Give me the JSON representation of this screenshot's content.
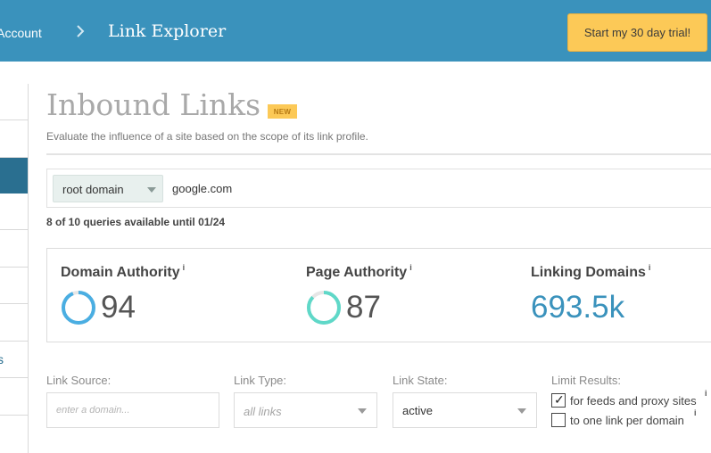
{
  "topbar": {
    "account_crumb": "s Account",
    "title": "Link Explorer",
    "trial_button": "Start my 30 day trial!"
  },
  "sidebar": {
    "partial_text": "s"
  },
  "header": {
    "title": "Inbound Links",
    "badge": "NEW",
    "subtitle": "Evaluate the influence of a site based on the scope of its link profile."
  },
  "search": {
    "scope": "root domain",
    "query": "google.com",
    "quota": "8 of 10 queries available until 01/24"
  },
  "metrics": [
    {
      "label": "Domain Authority",
      "info": "i",
      "value": "94",
      "score": 94,
      "ring_color": "#4aaee2"
    },
    {
      "label": "Page Authority",
      "info": "i",
      "value": "87",
      "score": 87,
      "ring_color": "#5fd8c8"
    },
    {
      "label": "Linking Domains",
      "info": "i",
      "value": "693.5k"
    }
  ],
  "filters": {
    "link_source": {
      "label": "Link Source:",
      "placeholder": "enter a domain..."
    },
    "link_type": {
      "label": "Link Type:",
      "value": "all links"
    },
    "link_state": {
      "label": "Link State:",
      "value": "active"
    },
    "limit_results": {
      "label": "Limit Results:",
      "options": [
        {
          "label": "for feeds and proxy sites",
          "checked": true,
          "info": "i"
        },
        {
          "label": "to one link per domain",
          "checked": false,
          "info": "i"
        }
      ]
    }
  },
  "colors": {
    "topbar": "#3a92bc",
    "trial_button": "#fcc957",
    "sidebar_active": "#2a6f90",
    "linking_domains": "#3a92bc"
  }
}
